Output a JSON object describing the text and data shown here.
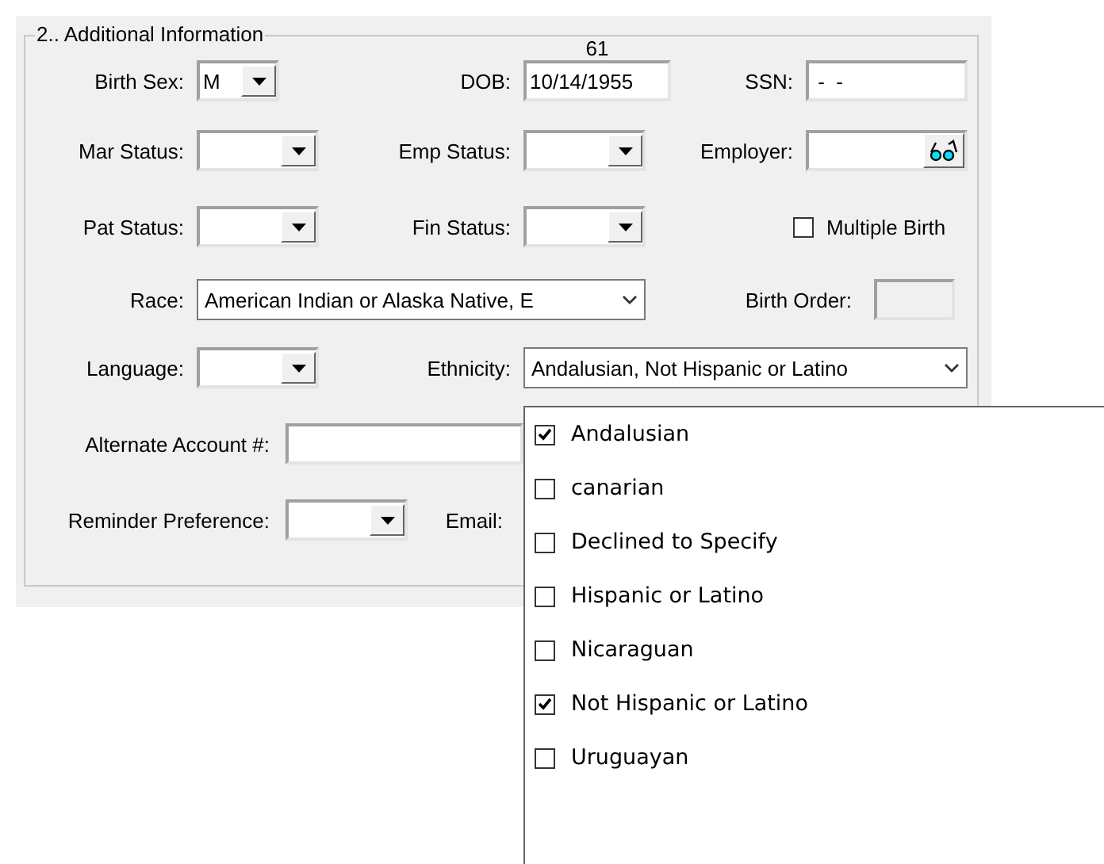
{
  "group_title": "2.. Additional Information",
  "age": "61",
  "birth_sex": {
    "label": "Birth Sex:",
    "value": "M"
  },
  "dob": {
    "label": "DOB:",
    "value": "10/14/1955"
  },
  "ssn": {
    "label": "SSN:",
    "value": " -  -"
  },
  "mar_status": {
    "label": "Mar Status:"
  },
  "emp_status": {
    "label": "Emp Status:"
  },
  "employer": {
    "label": "Employer:"
  },
  "pat_status": {
    "label": "Pat Status:"
  },
  "fin_status": {
    "label": "Fin Status:"
  },
  "multiple_birth": {
    "label": "Multiple Birth",
    "checked": false
  },
  "race": {
    "label": "Race:",
    "value": "American Indian or Alaska Native, E"
  },
  "birth_order": {
    "label": "Birth Order:"
  },
  "language": {
    "label": "Language:"
  },
  "ethnicity": {
    "label": "Ethnicity:",
    "value": "Andalusian, Not Hispanic or Latino",
    "expanded": true,
    "options": [
      {
        "label": "Andalusian",
        "checked": true
      },
      {
        "label": "canarian",
        "checked": false
      },
      {
        "label": "Declined to Specify",
        "checked": false
      },
      {
        "label": "Hispanic or Latino",
        "checked": false
      },
      {
        "label": "Nicaraguan",
        "checked": false
      },
      {
        "label": "Not Hispanic or Latino",
        "checked": true
      },
      {
        "label": "Uruguayan",
        "checked": false
      }
    ]
  },
  "alternate_account": {
    "label": "Alternate Account #:"
  },
  "reminder_preference": {
    "label": "Reminder Preference:"
  },
  "email": {
    "label": "Email:"
  }
}
